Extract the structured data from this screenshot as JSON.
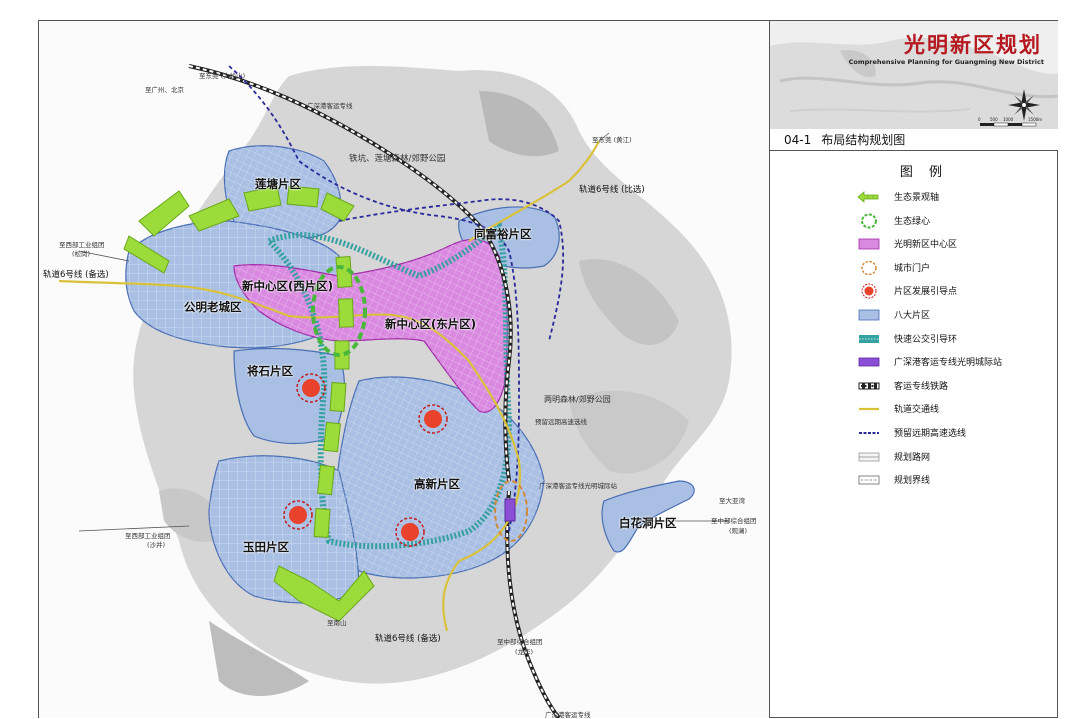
{
  "plan": {
    "title_cn": "光明新区规划",
    "title_en": "Comprehensive Planning for Guangming New District",
    "sheet_number": "04-1",
    "sheet_title": "布局结构规划图",
    "scale_labels": [
      "0",
      "500",
      "1000",
      "1500m"
    ]
  },
  "legend": {
    "title": "图  例",
    "items": [
      {
        "label": "生态景观轴",
        "icon": "eco-axis-arrow"
      },
      {
        "label": "生态绿心",
        "icon": "green-heart-ellipse"
      },
      {
        "label": "光明新区中心区",
        "icon": "center-area-fill"
      },
      {
        "label": "城市门户",
        "icon": "city-gate-ellipse"
      },
      {
        "label": "片区发展引导点",
        "icon": "guide-point-dot"
      },
      {
        "label": "八大片区",
        "icon": "district-fill"
      },
      {
        "label": "快速公交引导环",
        "icon": "brt-ring-band"
      },
      {
        "label": "广深港客运专线光明城际站",
        "icon": "intercity-station"
      },
      {
        "label": "客运专线铁路",
        "icon": "railway-line"
      },
      {
        "label": "轨道交通线",
        "icon": "metro-line"
      },
      {
        "label": "预留远期高速选线",
        "icon": "future-highway-line"
      },
      {
        "label": "规划路网",
        "icon": "road-network"
      },
      {
        "label": "规划界线",
        "icon": "planning-boundary"
      }
    ]
  },
  "map": {
    "districts": [
      {
        "name": "莲塘片区"
      },
      {
        "name": "公明老城区"
      },
      {
        "name": "新中心区(西片区)"
      },
      {
        "name": "新中心区(东片区)"
      },
      {
        "name": "同富裕片区"
      },
      {
        "name": "将石片区"
      },
      {
        "name": "高新片区"
      },
      {
        "name": "玉田片区"
      },
      {
        "name": "白花洞片区"
      }
    ],
    "parks": [
      {
        "name": "铁坑、莲塘森林/郊野公园"
      },
      {
        "name": "两明森林/郊野公园"
      }
    ],
    "line_labels": {
      "intercity_top": "广深港客运专线",
      "intercity_bottom": "广深港客运专线",
      "metro6_east": "轨道6号线 (比选)",
      "metro6_west": "轨道6号线 (备选)",
      "metro6_south": "轨道6号线 (备选)",
      "future_highway": "预留远期高速选线",
      "station": "广深港客运专线光明城际站"
    },
    "direction_labels": {
      "dongguan": "至东莞 (大岭山)",
      "guangzhou": "至广州、北京",
      "songgang": "至西部工业组团",
      "songgang_sub": "(松岗)",
      "shajing": "至西部工业组团",
      "shajing_sub": "(沙井)",
      "huangjiang": "至东莞 (黄江)",
      "dalingshan": "至大亚湾",
      "guanlan": "至中部综合组团",
      "guanlan_sub": "(观澜)",
      "longhua": "至中部综合组团",
      "longhua_sub": "(龙华)",
      "nanshan": "至南山"
    }
  }
}
